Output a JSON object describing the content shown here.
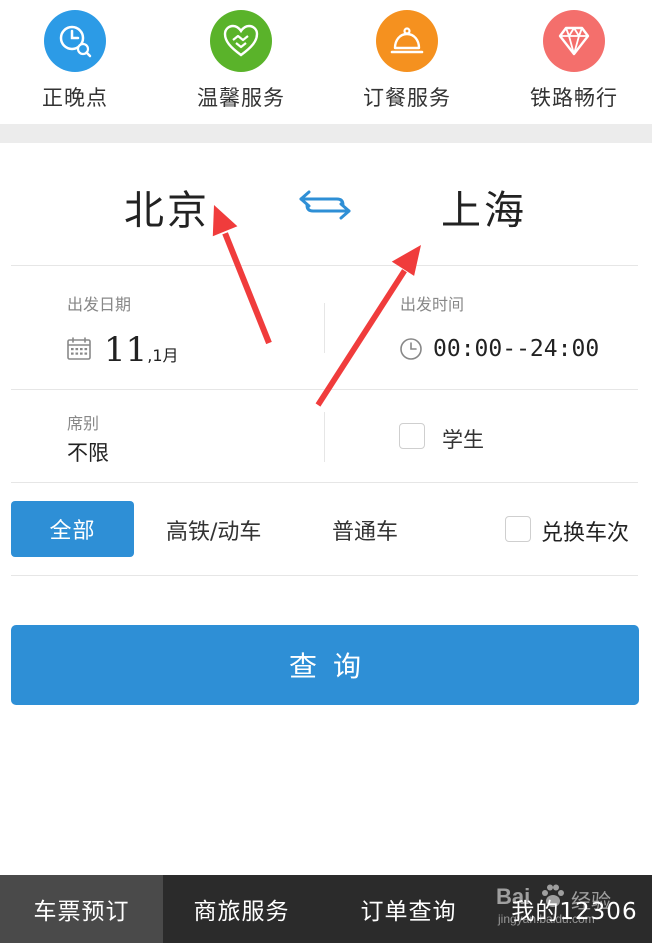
{
  "quick_services": [
    {
      "label": "正晚点",
      "icon": "clock-search-icon",
      "color": "#2c9be6"
    },
    {
      "label": "温馨服务",
      "icon": "handshake-heart-icon",
      "color": "#5ab32a"
    },
    {
      "label": "订餐服务",
      "icon": "cloche-icon",
      "color": "#f5911f"
    },
    {
      "label": "铁路畅行",
      "icon": "diamond-icon",
      "color": "#f46f6c"
    }
  ],
  "route": {
    "from_city": "北京",
    "to_city": "上海",
    "swap_icon": "swap-arrows-icon"
  },
  "departure_date": {
    "label": "出发日期",
    "day": "11",
    "month_suffix": ",1月",
    "icon": "calendar-icon"
  },
  "departure_time": {
    "label": "出发时间",
    "value": "00:00--24:00",
    "icon": "clock-icon"
  },
  "seat_class": {
    "label": "席别",
    "value": "不限"
  },
  "student": {
    "label": "学生",
    "checked": false
  },
  "train_types": {
    "tabs": [
      "全部",
      "高铁/动车",
      "普通车"
    ],
    "active": "全部",
    "exchange_label": "兑换车次",
    "exchange_checked": false
  },
  "query_button": {
    "label": "查询"
  },
  "bottom_nav": [
    {
      "label": "车票预订",
      "active": true
    },
    {
      "label": "商旅服务",
      "active": false
    },
    {
      "label": "订单查询",
      "active": false
    },
    {
      "label": "我的12306",
      "active": false
    }
  ],
  "watermark": {
    "brand": "Bai",
    "brand_suffix": "经验",
    "url": "jingyan.baidu.com"
  },
  "colors": {
    "accent": "#2e8fd6",
    "annotation_arrow": "#f03c3c",
    "nav_bg": "#2b2b2b",
    "nav_active_bg": "#4a4a4a"
  }
}
